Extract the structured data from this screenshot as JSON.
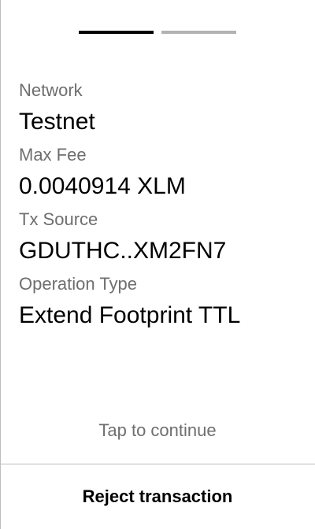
{
  "pager": {
    "current_page": 1,
    "total_pages": 2
  },
  "fields": [
    {
      "label": "Network",
      "value": "Testnet"
    },
    {
      "label": "Max Fee",
      "value": "0.0040914 XLM"
    },
    {
      "label": "Tx Source",
      "value": "GDUTHC..XM2FN7"
    },
    {
      "label": "Operation Type",
      "value": "Extend Footprint TTL"
    }
  ],
  "tap_hint": "Tap to continue",
  "actions": {
    "reject_label": "Reject transaction"
  },
  "colors": {
    "active_indicator": "#000000",
    "inactive_indicator": "#b3b3b3",
    "label_text": "#6e6e6e",
    "value_text": "#000000",
    "divider": "#bdbdbd"
  }
}
